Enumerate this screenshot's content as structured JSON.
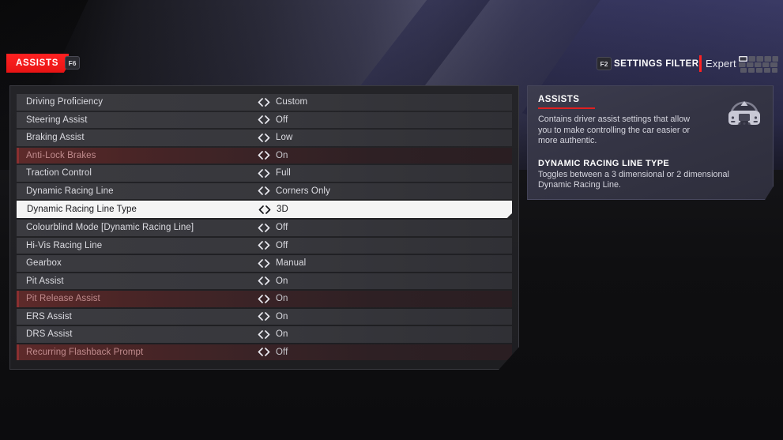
{
  "topbar": {
    "tab_label": "ASSISTS",
    "tab_key": "F6",
    "filter_key": "F2",
    "filter_label": "SETTINGS FILTER",
    "filter_value": "Expert",
    "keyboard_icon": "keyboard-icon"
  },
  "settings": {
    "rows": [
      {
        "label": "Driving Proficiency",
        "value": "Custom",
        "state": "normal"
      },
      {
        "label": "Steering Assist",
        "value": "Off",
        "state": "normal"
      },
      {
        "label": "Braking Assist",
        "value": "Low",
        "state": "normal"
      },
      {
        "label": "Anti-Lock Brakes",
        "value": "On",
        "state": "warn"
      },
      {
        "label": "Traction Control",
        "value": "Full",
        "state": "normal"
      },
      {
        "label": "Dynamic Racing Line",
        "value": "Corners Only",
        "state": "normal"
      },
      {
        "label": "Dynamic Racing Line Type",
        "value": "3D",
        "state": "selected"
      },
      {
        "label": "Colourblind Mode [Dynamic Racing Line]",
        "value": "Off",
        "state": "normal"
      },
      {
        "label": "Hi-Vis Racing Line",
        "value": "Off",
        "state": "normal"
      },
      {
        "label": "Gearbox",
        "value": "Manual",
        "state": "normal"
      },
      {
        "label": "Pit Assist",
        "value": "On",
        "state": "normal"
      },
      {
        "label": "Pit Release Assist",
        "value": "On",
        "state": "warn"
      },
      {
        "label": "ERS Assist",
        "value": "On",
        "state": "normal"
      },
      {
        "label": "DRS Assist",
        "value": "On",
        "state": "normal"
      },
      {
        "label": "Recurring Flashback Prompt",
        "value": "Off",
        "state": "warn"
      }
    ]
  },
  "info": {
    "title": "ASSISTS",
    "body": "Contains driver assist settings that allow you to make controlling the car easier or more authentic.",
    "sub_title": "DYNAMIC RACING LINE TYPE",
    "sub_body": "Toggles between a 3 dimensional or 2 dimensional Dynamic Racing Line.",
    "icon": "steering-wheel-icon"
  },
  "colors": {
    "accent_red": "#e81414",
    "warn_row": "#5e2a2a",
    "selected_row": "#f4f4f4",
    "panel_bg": "#242428",
    "info_bg": "#3c3c4e"
  }
}
